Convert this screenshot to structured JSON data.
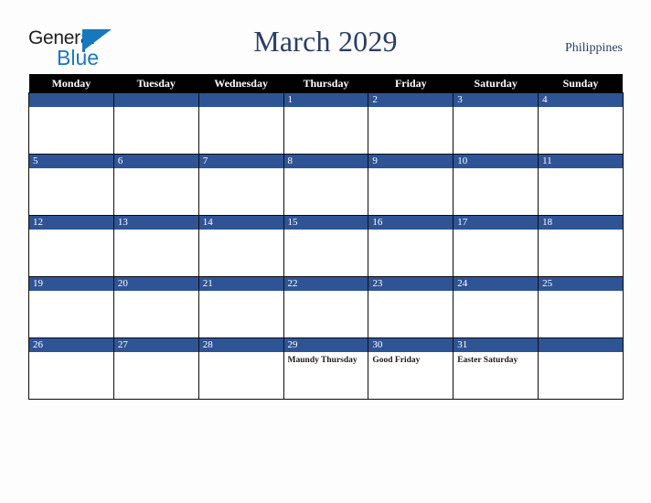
{
  "brand": {
    "name_part1": "General",
    "name_part2": "Blue",
    "accent_color": "#1878be"
  },
  "header": {
    "title": "March 2029",
    "region": "Philippines",
    "title_color": "#2b3f63"
  },
  "calendar": {
    "weekday_headers": [
      "Monday",
      "Tuesday",
      "Wednesday",
      "Thursday",
      "Friday",
      "Saturday",
      "Sunday"
    ],
    "header_bg": "#000000",
    "daybar_bg": "#2f5496",
    "weeks": [
      [
        {
          "day": "",
          "events": []
        },
        {
          "day": "",
          "events": []
        },
        {
          "day": "",
          "events": []
        },
        {
          "day": "1",
          "events": []
        },
        {
          "day": "2",
          "events": []
        },
        {
          "day": "3",
          "events": []
        },
        {
          "day": "4",
          "events": []
        }
      ],
      [
        {
          "day": "5",
          "events": []
        },
        {
          "day": "6",
          "events": []
        },
        {
          "day": "7",
          "events": []
        },
        {
          "day": "8",
          "events": []
        },
        {
          "day": "9",
          "events": []
        },
        {
          "day": "10",
          "events": []
        },
        {
          "day": "11",
          "events": []
        }
      ],
      [
        {
          "day": "12",
          "events": []
        },
        {
          "day": "13",
          "events": []
        },
        {
          "day": "14",
          "events": []
        },
        {
          "day": "15",
          "events": []
        },
        {
          "day": "16",
          "events": []
        },
        {
          "day": "17",
          "events": []
        },
        {
          "day": "18",
          "events": []
        }
      ],
      [
        {
          "day": "19",
          "events": []
        },
        {
          "day": "20",
          "events": []
        },
        {
          "day": "21",
          "events": []
        },
        {
          "day": "22",
          "events": []
        },
        {
          "day": "23",
          "events": []
        },
        {
          "day": "24",
          "events": []
        },
        {
          "day": "25",
          "events": []
        }
      ],
      [
        {
          "day": "26",
          "events": []
        },
        {
          "day": "27",
          "events": []
        },
        {
          "day": "28",
          "events": []
        },
        {
          "day": "29",
          "events": [
            "Maundy Thursday"
          ]
        },
        {
          "day": "30",
          "events": [
            "Good Friday"
          ]
        },
        {
          "day": "31",
          "events": [
            "Easter Saturday"
          ]
        },
        {
          "day": "",
          "events": []
        }
      ]
    ]
  }
}
